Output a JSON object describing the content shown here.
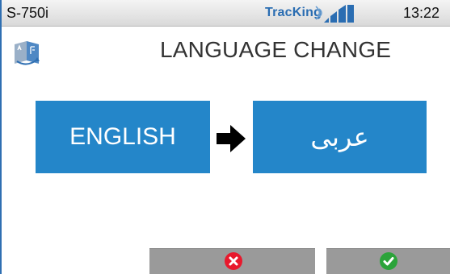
{
  "status_bar": {
    "device_name": "S-750i",
    "brand": "TracKing",
    "time": "13:22",
    "signal_level": 4,
    "signal_max": 4
  },
  "header": {
    "title": "LANGUAGE CHANGE",
    "icon": "language-translate-icon"
  },
  "language": {
    "from": "ENGLISH",
    "to": "عربى",
    "arrow_icon": "arrow-right-icon"
  },
  "actions": {
    "cancel_icon": "close-circle-icon",
    "confirm_icon": "check-circle-icon",
    "cancel_color": "#e8182c",
    "confirm_color": "#2ba33a"
  },
  "colors": {
    "accent": "#2486c9",
    "brand": "#2a6db2"
  }
}
